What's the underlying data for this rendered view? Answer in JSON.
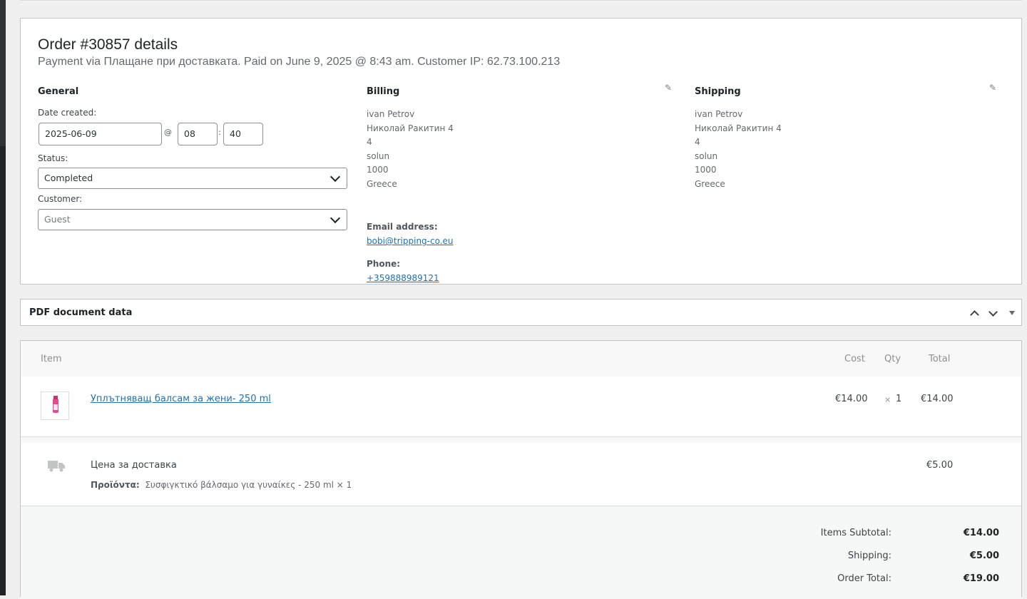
{
  "order": {
    "title": "Order #30857 details",
    "meta": "Payment via Плащане при доставката. Paid on June 9, 2025 @ 8:43 am. Customer IP: 62.73.100.213"
  },
  "general": {
    "heading": "General",
    "date_label": "Date created:",
    "date_value": "2025-06-09",
    "at": "@",
    "hour": "08",
    "colon": ":",
    "minute": "40",
    "status_label": "Status:",
    "status_value": "Completed",
    "customer_label": "Customer:",
    "customer_placeholder": "Guest"
  },
  "billing": {
    "heading": "Billing",
    "lines": [
      "ivan Petrov",
      "Николай Ракитин 4",
      "4",
      "solun",
      "1000",
      "Greece"
    ],
    "email_label": "Email address:",
    "email": "bobi@tripping-co.eu",
    "phone_label": "Phone:",
    "phone": "+359888989121"
  },
  "shipping": {
    "heading": "Shipping",
    "lines": [
      "ivan Petrov",
      "Николай Ракитин 4",
      "4",
      "solun",
      "1000",
      "Greece"
    ]
  },
  "pdf": {
    "title": "PDF document data"
  },
  "items": {
    "headers": {
      "item": "Item",
      "cost": "Cost",
      "qty": "Qty",
      "total": "Total"
    },
    "product": {
      "name": "Уплътняващ балсам за жени- 250 ml",
      "cost": "€14.00",
      "qty_x": "×",
      "qty": "1",
      "total": "€14.00"
    },
    "shipping_line": {
      "name": "Цена за доставка",
      "meta_label": "Προϊόντα:",
      "meta_value": "Συσφιγκτικό βάλσαμο για γυναίκες - 250 ml × 1",
      "total": "€5.00"
    }
  },
  "totals": {
    "subtotal_label": "Items Subtotal:",
    "subtotal": "€14.00",
    "shipping_label": "Shipping:",
    "shipping": "€5.00",
    "order_total_label": "Order Total:",
    "order_total": "€19.00"
  },
  "colors": {
    "link": "#2271b1",
    "border": "#c3c4c7",
    "background": "#f0f0f1"
  },
  "icons": [
    "pencil-icon",
    "chevron-up-icon",
    "chevron-down-icon",
    "triangle-down-icon",
    "truck-icon"
  ]
}
